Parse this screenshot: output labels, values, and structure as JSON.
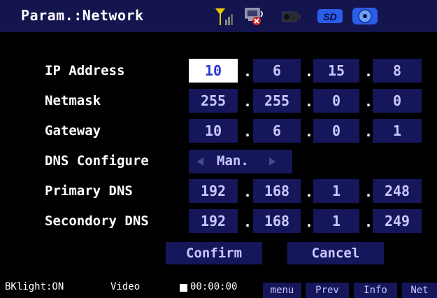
{
  "title": "Param.:Network",
  "status_icons": [
    "signal-icon",
    "display-muted-icon",
    "camera-icon",
    "sd-card-icon",
    "disc-icon"
  ],
  "sd_label": "SD",
  "rows": {
    "ip": {
      "label": "IP Address",
      "octets": [
        "10",
        "6",
        "15",
        "8"
      ]
    },
    "netmask": {
      "label": "Netmask",
      "octets": [
        "255",
        "255",
        "0",
        "0"
      ]
    },
    "gateway": {
      "label": "Gateway",
      "octets": [
        "10",
        "6",
        "0",
        "1"
      ]
    },
    "dns_config": {
      "label": "DNS Configure",
      "value": "Man."
    },
    "primary_dns": {
      "label": "Primary DNS",
      "octets": [
        "192",
        "168",
        "1",
        "248"
      ]
    },
    "secondary_dns": {
      "label": "Secondory DNS",
      "octets": [
        "192",
        "168",
        "1",
        "249"
      ]
    }
  },
  "separator": ".",
  "buttons": {
    "confirm": "Confirm",
    "cancel": "Cancel"
  },
  "footer": {
    "backlight": "BKlight:ON",
    "video": "Video",
    "time": "00:00:00",
    "softkeys": [
      "menu",
      "Prev",
      "Info",
      "Net"
    ]
  },
  "colors": {
    "title_bar": "#14144f",
    "cell": "#16165a",
    "cell_text": "#c8c8ff",
    "selected_text": "#2a3bd0"
  }
}
